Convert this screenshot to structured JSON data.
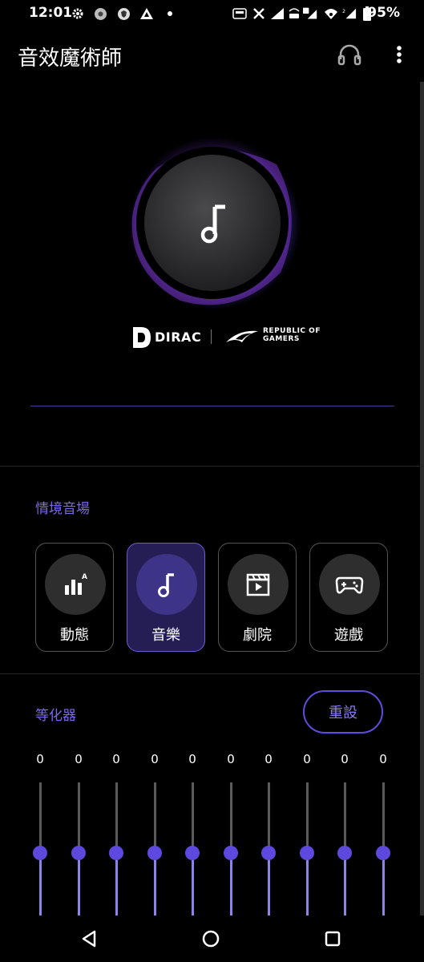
{
  "status_bar": {
    "time": "12:01",
    "battery": "95%",
    "icons": [
      "gear-icon",
      "globe-icon",
      "shield-icon",
      "triangle-icon",
      "dot-icon",
      "hz-icon",
      "x-icon",
      "signal-vowifi-icon",
      "lte-icon",
      "wifi-icon",
      "signal-2-icon",
      "battery-icon"
    ]
  },
  "app_bar": {
    "title": "音效魔術師"
  },
  "brand": {
    "dirac": "DIRAC",
    "rog_line1": "REPUBLIC OF",
    "rog_line2": "GAMERS"
  },
  "scenes": {
    "title": "情境音場",
    "items": [
      {
        "label": "動態",
        "icon": "dynamic-bars-icon",
        "active": false
      },
      {
        "label": "音樂",
        "icon": "music-note-icon",
        "active": true
      },
      {
        "label": "劇院",
        "icon": "movie-clapper-icon",
        "active": false
      },
      {
        "label": "遊戲",
        "icon": "gamepad-icon",
        "active": false
      }
    ]
  },
  "equalizer": {
    "title": "等化器",
    "reset_label": "重設",
    "bands": [
      {
        "value": "0"
      },
      {
        "value": "0"
      },
      {
        "value": "0"
      },
      {
        "value": "0"
      },
      {
        "value": "0"
      },
      {
        "value": "0"
      },
      {
        "value": "0"
      },
      {
        "value": "0"
      },
      {
        "value": "0"
      },
      {
        "value": "0"
      }
    ]
  },
  "colors": {
    "accent": "#7b68e8",
    "active_card_bg": "#251e55",
    "thumb": "#5d49e0"
  }
}
